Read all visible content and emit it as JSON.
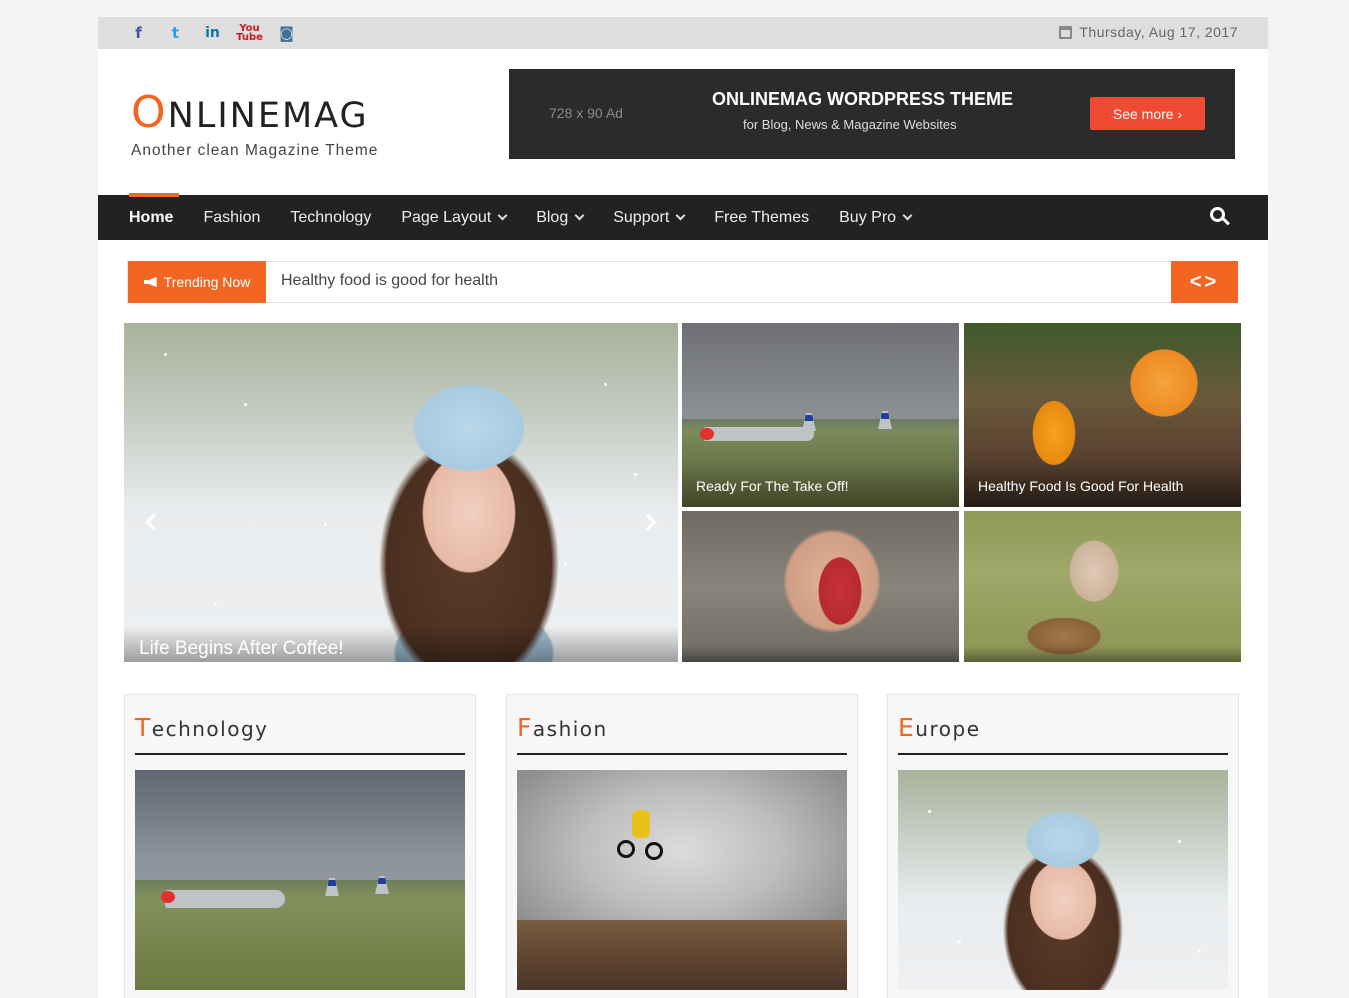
{
  "topbar": {
    "social_icons": [
      "facebook-icon",
      "twitter-icon",
      "linkedin-icon",
      "youtube-icon",
      "instagram-icon"
    ],
    "social_glyphs": {
      "facebook": "f",
      "twitter": "t",
      "linkedin": "in",
      "youtube": "You Tube",
      "instagram": "◙"
    },
    "date": "Thursday, Aug 17, 2017"
  },
  "header": {
    "logo_first": "O",
    "logo_rest": "NLINEMAG",
    "tagline": "Another clean Magazine Theme"
  },
  "ad": {
    "size": "728 x 90 Ad",
    "title": "ONLINEMAG WORDPRESS THEME",
    "subtitle": "for Blog, News & Magazine Websites",
    "button": "See more ›"
  },
  "nav": {
    "items": [
      {
        "label": "Home",
        "dropdown": false
      },
      {
        "label": "Fashion",
        "dropdown": false
      },
      {
        "label": "Technology",
        "dropdown": false
      },
      {
        "label": "Page Layout",
        "dropdown": true
      },
      {
        "label": "Blog",
        "dropdown": true
      },
      {
        "label": "Support",
        "dropdown": true
      },
      {
        "label": "Free Themes",
        "dropdown": false
      },
      {
        "label": "Buy Pro",
        "dropdown": true
      }
    ]
  },
  "trending": {
    "label": "Trending Now",
    "headline": "Healthy food is good for health",
    "arrows": "<>"
  },
  "featured": {
    "main_caption": "Life Begins After Coffee!",
    "plane_caption": "Ready For The Take Off!",
    "juice_caption": "Healthy Food Is Good For Health"
  },
  "categories": [
    {
      "first": "T",
      "rest": "echnology"
    },
    {
      "first": "F",
      "rest": "ashion"
    },
    {
      "first": "E",
      "rest": "urope"
    }
  ],
  "colors": {
    "accent": "#f26522",
    "nav_bg": "#222222",
    "topbar_bg": "#dedede",
    "ad_button": "#f04a32"
  }
}
